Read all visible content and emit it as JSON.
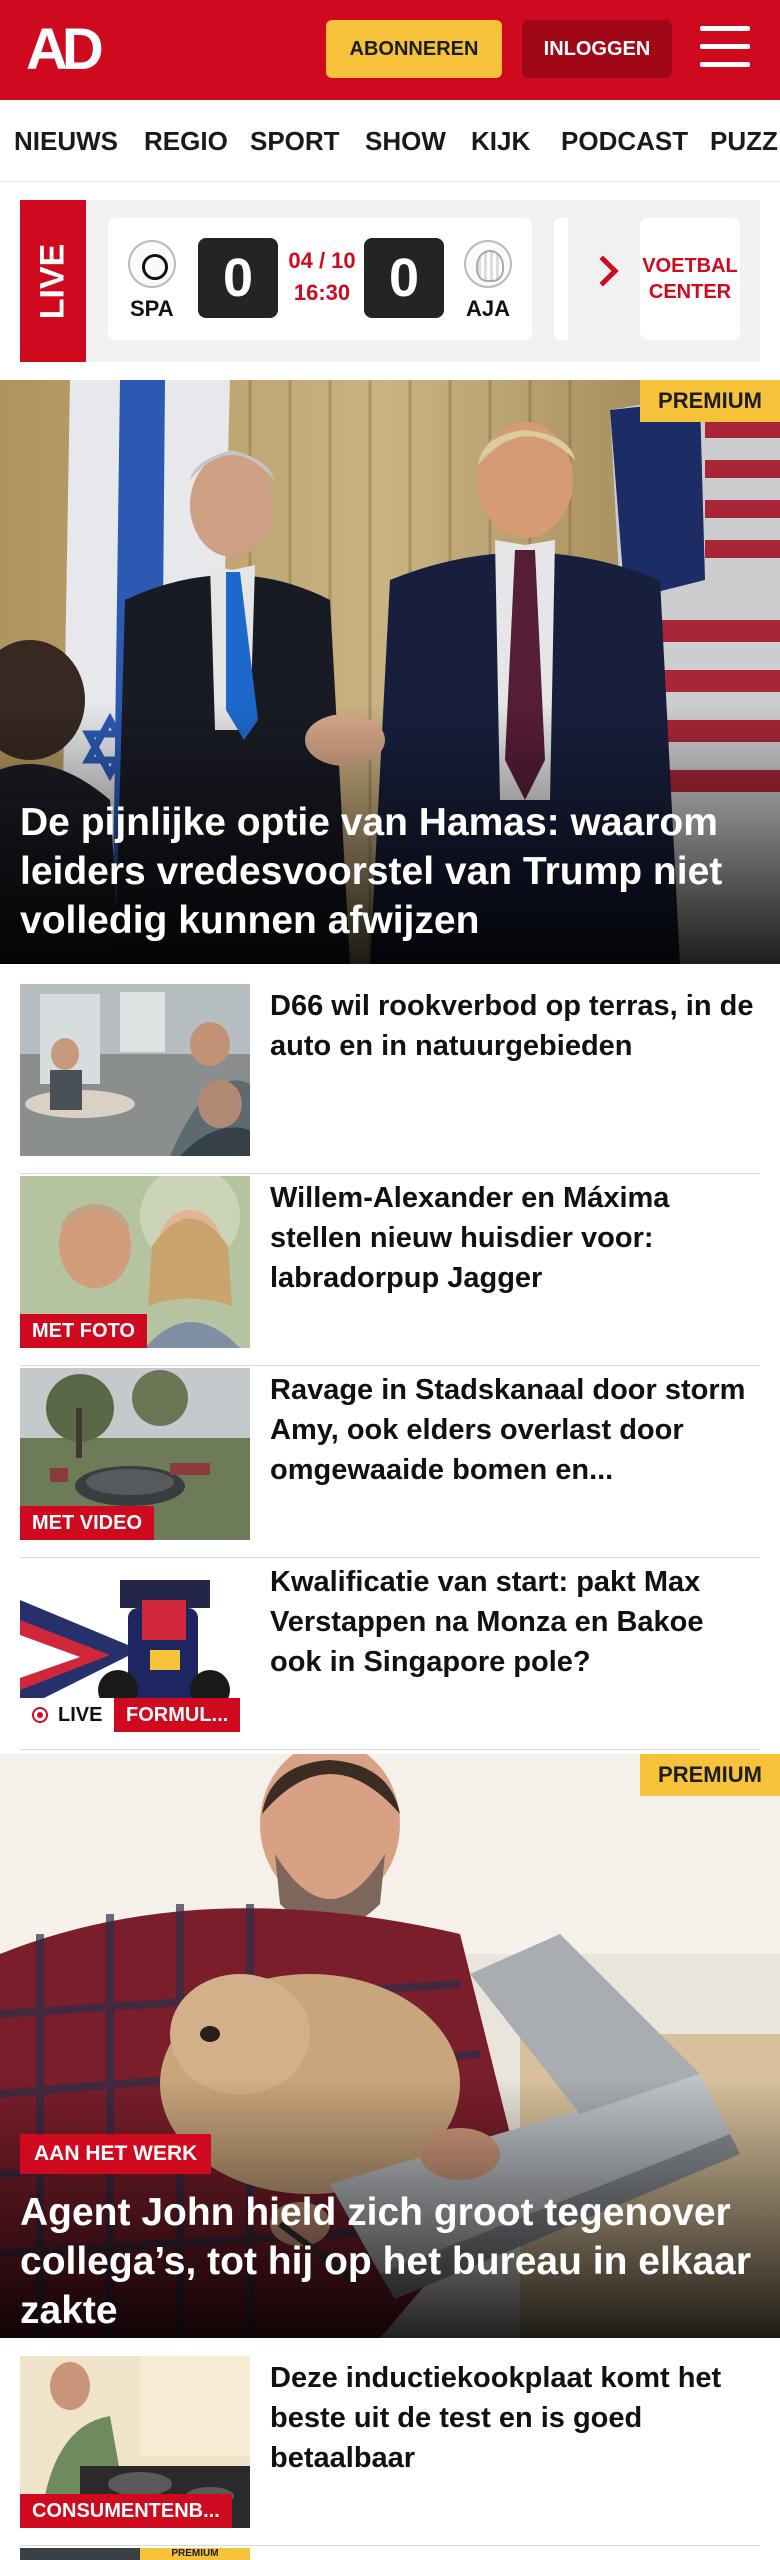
{
  "header": {
    "logo_text": "AD",
    "subscribe_label": "ABONNEREN",
    "login_label": "INLOGGEN",
    "brand_red": "#cf0a1f",
    "accent_yellow": "#f6c23a"
  },
  "nav": {
    "items": [
      "NIEUWS",
      "REGIO",
      "SPORT",
      "SHOW",
      "KIJK",
      "PODCAST",
      "PUZZ"
    ]
  },
  "live": {
    "label": "LIVE",
    "match": {
      "home_team": "SPA",
      "away_team": "AJA",
      "home_score": "0",
      "away_score": "0",
      "date": "04 / 10",
      "time": "16:30"
    },
    "football_center_label": "VOETBAL CENTER"
  },
  "hero": {
    "premium_label": "PREMIUM",
    "title": "De pijnlijke optie van Hamas: waarom leiders vredesvoorstel van Trump niet volledig kunnen afwijzen"
  },
  "articles": [
    {
      "title": "D66 wil rookverbod op terras, in de auto en in natuurgebieden",
      "badge": ""
    },
    {
      "title": "Willem-Alexander en Máxima stellen nieuw huisdier voor: labradorpup Jagger",
      "badge": "MET FOTO"
    },
    {
      "title": "Ravage in Stadskanaal door storm Amy, ook elders overlast door omgewaaide bomen en...",
      "badge": "MET VIDEO"
    },
    {
      "title": "Kwalificatie van start: pakt Max Verstappen na Monza en Bakoe ook in Singapore pole?",
      "badge": "FORMUL...",
      "live_label": "LIVE"
    }
  ],
  "feature": {
    "premium_label": "PREMIUM",
    "category": "AAN HET WERK",
    "title": "Agent John hield zich groot tegenover collega’s, tot hij op het bureau in elkaar zakte"
  },
  "articles2": [
    {
      "title": "Deze inductiekookplaat komt het beste uit de test en is goed betaalbaar",
      "badge": "CONSUMENTENB..."
    },
    {
      "badge": "PREMIUM"
    }
  ]
}
